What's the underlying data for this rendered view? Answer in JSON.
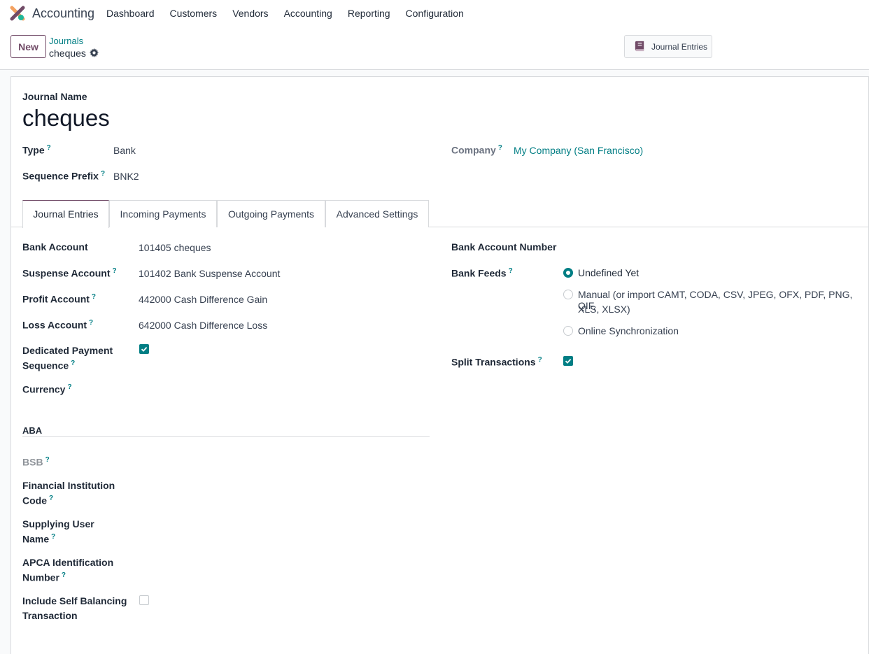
{
  "app": {
    "name": "Accounting"
  },
  "menu": [
    "Dashboard",
    "Customers",
    "Vendors",
    "Accounting",
    "Reporting",
    "Configuration"
  ],
  "control": {
    "new_label": "New",
    "breadcrumb_parent": "Journals",
    "breadcrumb_current": "cheques",
    "smart_button": "Journal Entries"
  },
  "form": {
    "journal_name_label": "Journal Name",
    "journal_name": "cheques",
    "type_label": "Type",
    "type_value": "Bank",
    "prefix_label": "Sequence Prefix",
    "prefix_value": "BNK2",
    "company_label": "Company",
    "company_value": "My Company (San Francisco)",
    "tooltip_mark": "?"
  },
  "tabs": [
    "Journal Entries",
    "Incoming Payments",
    "Outgoing Payments",
    "Advanced Settings"
  ],
  "left": {
    "bank_account_label": "Bank Account",
    "bank_account_value": "101405 cheques",
    "suspense_label": "Suspense Account",
    "suspense_value": "101402 Bank Suspense Account",
    "profit_label": "Profit Account",
    "profit_value": "442000 Cash Difference Gain",
    "loss_label": "Loss Account",
    "loss_value": "642000 Cash Difference Loss",
    "dedicated_label_1": "Dedicated Payment",
    "dedicated_label_2": "Sequence",
    "dedicated_checked": true,
    "currency_label": "Currency",
    "aba_header": "ABA",
    "bsb_label": "BSB",
    "fic_label_1": "Financial Institution",
    "fic_label_2": "Code",
    "supplying_label_1": "Supplying User",
    "supplying_label_2": "Name",
    "apca_label_1": "APCA Identification",
    "apca_label_2": "Number",
    "self_bal_label_1": "Include Self Balancing",
    "self_bal_label_2": "Transaction",
    "self_bal_checked": false
  },
  "right": {
    "bank_number_label": "Bank Account Number",
    "bank_feeds_label": "Bank Feeds",
    "feed_options": [
      "Undefined Yet",
      "Manual (or import CAMT, CODA, CSV, JPEG, OFX, PDF, PNG, QIF,",
      "XLS, XLSX)",
      "Online Synchronization"
    ],
    "feed_selected": "Undefined Yet",
    "split_label": "Split Transactions",
    "split_checked": true
  },
  "colors": {
    "brand": "#714b67",
    "accent": "#017e84"
  }
}
